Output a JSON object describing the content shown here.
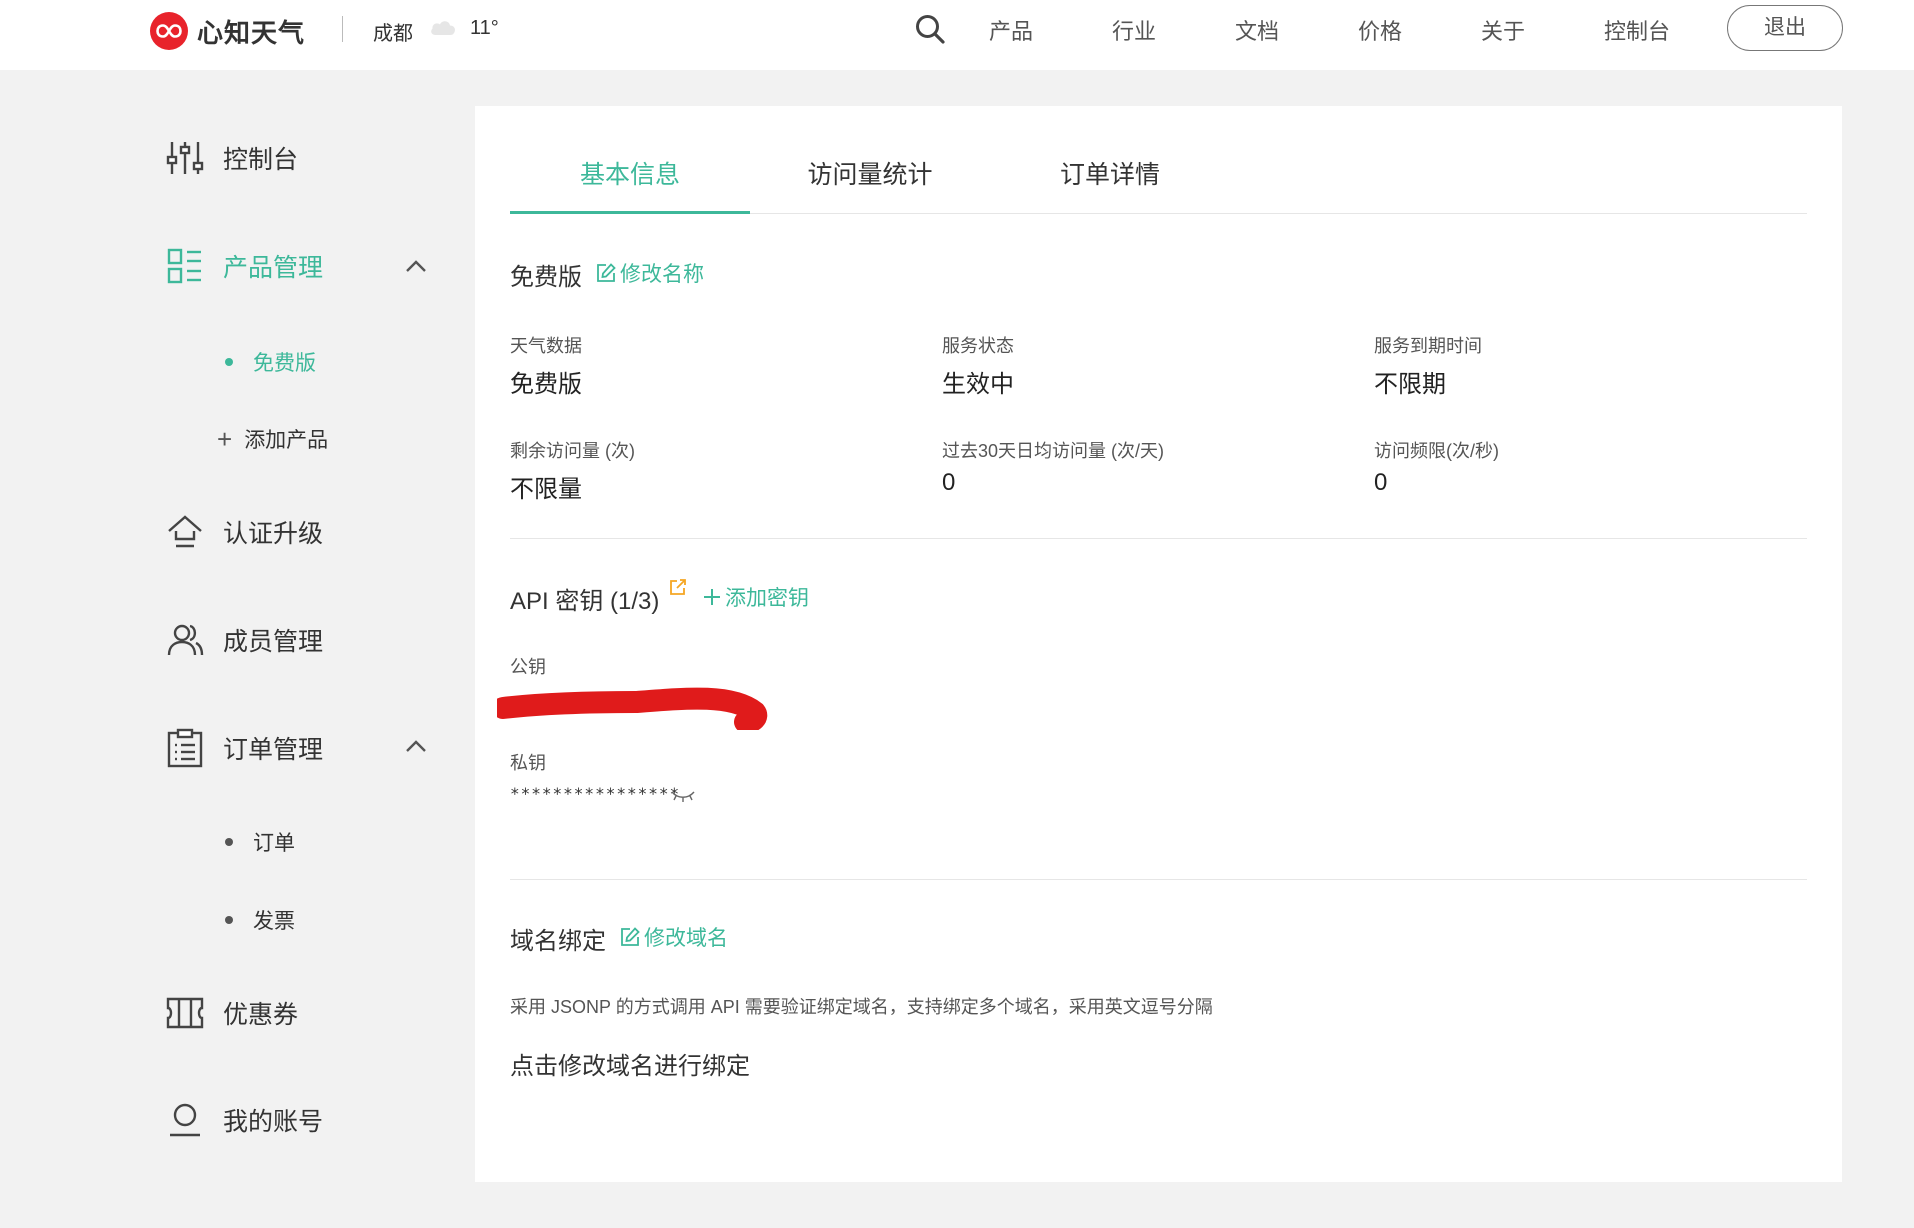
{
  "header": {
    "logo_text": "心知天气",
    "city": "成都",
    "temperature": "11°",
    "nav": [
      "产品",
      "行业",
      "文档",
      "价格",
      "关于",
      "控制台"
    ],
    "logout": "退出"
  },
  "sidebar": {
    "items": [
      {
        "label": "控制台",
        "icon": "sliders-icon"
      },
      {
        "label": "产品管理",
        "icon": "grid-list-icon",
        "active": true,
        "expanded": true
      },
      {
        "label": "认证升级",
        "icon": "upgrade-arrow-icon"
      },
      {
        "label": "成员管理",
        "icon": "users-icon"
      },
      {
        "label": "订单管理",
        "icon": "clipboard-icon",
        "expanded": true
      },
      {
        "label": "优惠券",
        "icon": "ticket-icon"
      },
      {
        "label": "我的账号",
        "icon": "user-icon"
      }
    ],
    "product_sub": [
      {
        "label": "免费版",
        "active": true
      },
      {
        "label": "添加产品",
        "icon": "plus-icon"
      }
    ],
    "order_sub": [
      {
        "label": "订单"
      },
      {
        "label": "发票"
      }
    ]
  },
  "tabs": [
    "基本信息",
    "访问量统计",
    "订单详情"
  ],
  "product": {
    "name": "免费版",
    "rename_link": "修改名称",
    "fields": [
      {
        "label": "天气数据",
        "value": "免费版"
      },
      {
        "label": "服务状态",
        "value": "生效中"
      },
      {
        "label": "服务到期时间",
        "value": "不限期"
      },
      {
        "label": "剩余访问量 (次)",
        "value": "不限量"
      },
      {
        "label": "过去30天日均访问量 (次/天)",
        "value": "0"
      },
      {
        "label": "访问频限(次/秒)",
        "value": "0"
      }
    ]
  },
  "api_keys": {
    "title": "API 密钥 (1/3)",
    "add_link": "添加密钥",
    "public_label": "公钥",
    "public_key_redacted": true,
    "private_label": "私钥",
    "private_key_masked": "****************"
  },
  "domain": {
    "title": "域名绑定",
    "edit_link": "修改域名",
    "description": "采用 JSONP 的方式调用 API 需要验证绑定域名，支持绑定多个域名，采用英文逗号分隔",
    "hint": "点击修改域名进行绑定"
  },
  "colors": {
    "accent": "#3db89a",
    "brand": "#e8232b",
    "link_orange": "#f5a623",
    "redaction": "#e01b1b"
  }
}
